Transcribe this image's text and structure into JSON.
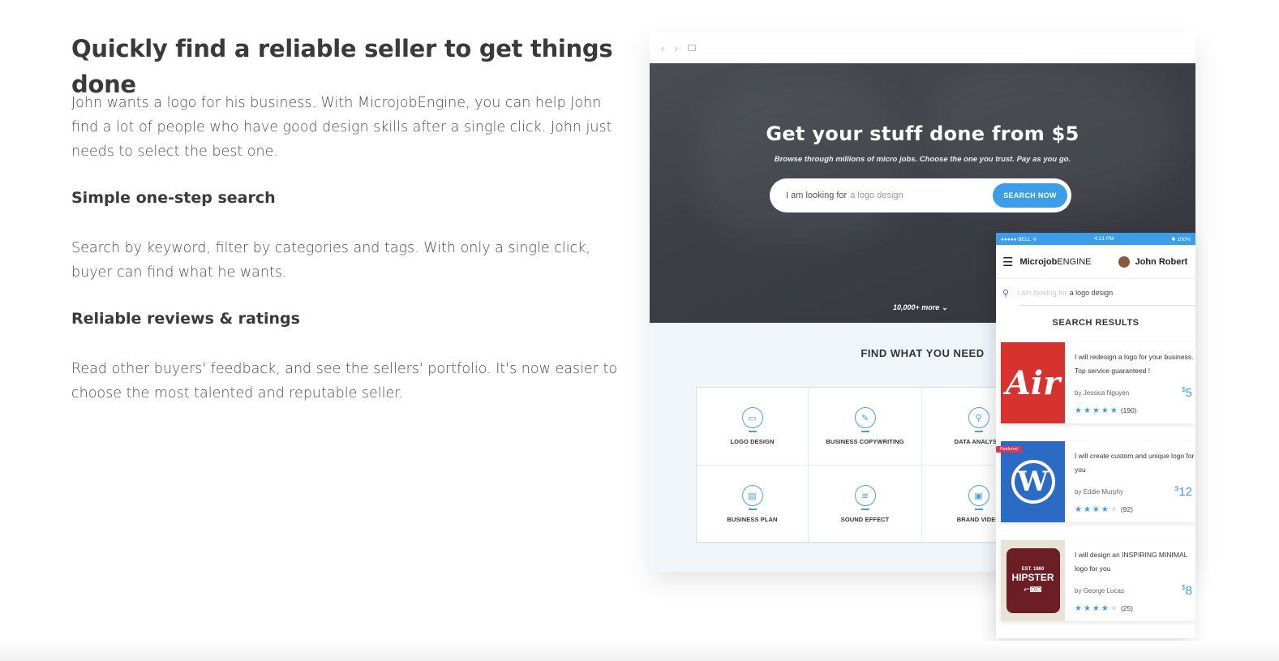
{
  "section": {
    "title": "Quickly find a reliable seller to get things done",
    "intro": "John wants a logo for his business. With MicrojobEngine, you can help John find a lot of people who have good design skills after a single click. John just needs to select the best one.",
    "features": [
      {
        "heading": "Simple one-step search",
        "text": "Search by keyword, filter by categories and tags. With only a single click, buyer can find what he wants."
      },
      {
        "heading": "Reliable reviews & ratings",
        "text": "Read other buyers' feedback, and see the sellers' portfolio. It's now easier to choose the most talented and reputable seller."
      }
    ]
  },
  "desktop": {
    "hero_title": "Get your stuff done from $5",
    "hero_subtitle": "Browse through millions of micro jobs. Choose the one you trust. Pay as you go.",
    "search_prefix": "I am looking for",
    "search_placeholder": "a logo design",
    "search_button": "SEARCH NOW",
    "more_label": "10,000+ more",
    "find_title": "FIND WHAT YOU NEED",
    "categories": [
      {
        "label": "LOGO DESIGN",
        "icon": "monitor-icon"
      },
      {
        "label": "BUSINESS COPYWRITING",
        "icon": "pen-icon"
      },
      {
        "label": "DATA ANALYSIS",
        "icon": "magnifier-icon"
      },
      {
        "label": "BUSINESS PLAN",
        "icon": "document-icon"
      },
      {
        "label": "SOUND EFFECT",
        "icon": "equalizer-icon"
      },
      {
        "label": "BRAND VIDEO",
        "icon": "chat-icon"
      }
    ]
  },
  "phone": {
    "status_left": "●●●●● BELL ᯤ",
    "status_time": "4:21 PM",
    "status_right": "✱ 100%",
    "brand_bold": "Microjob",
    "brand_rest": "ENGINE",
    "user_name": "John Robert",
    "search_placeholder": "I am looking for",
    "search_value": "a logo design",
    "results_title": "SEARCH RESULTS",
    "results": [
      {
        "title": "I will redesign a logo for your business. Top service guaranteed !",
        "by": "by",
        "seller": "Jessica Nguyen",
        "price": "5",
        "rating": 5,
        "reviews": "(190)",
        "thumb": "Air"
      },
      {
        "title": "I will create custom and unique logo for you",
        "by": "by",
        "seller": "Eddie Murphy",
        "price": "12",
        "rating": 4,
        "reviews": "(92)",
        "thumb": "W",
        "featured": "Featured"
      },
      {
        "title": "I will design an INSPIRING MINIMAL logo for you",
        "by": "by",
        "seller": "George Lucas",
        "price": "8",
        "rating": 4,
        "reviews": "(25)",
        "thumb": "HIPSTER",
        "thumb_est": "EST. 1860"
      }
    ]
  },
  "colors": {
    "accent": "#3c9de8",
    "hero_bg": "#3d3f47",
    "air_red": "#d8322e",
    "wp_blue": "#2b6bc6",
    "hipster_maroon": "#6b1e26"
  }
}
